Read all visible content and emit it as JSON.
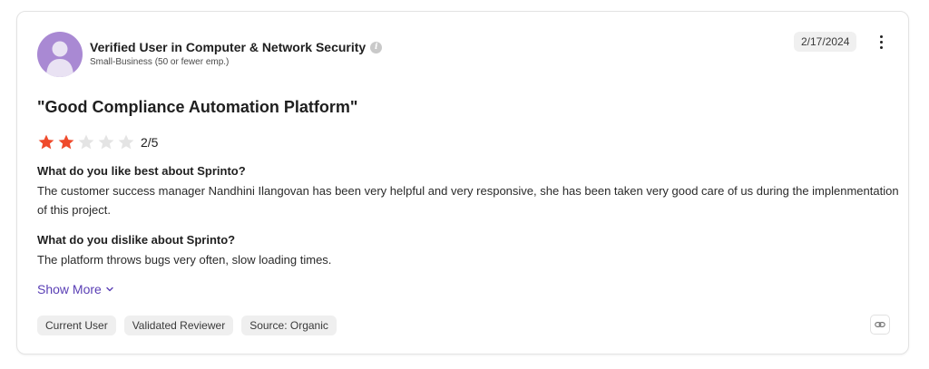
{
  "review": {
    "reviewer_name": "Verified User in Computer & Network Security",
    "reviewer_segment": "Small-Business (50 or fewer emp.)",
    "info_symbol": "i",
    "date": "2/17/2024",
    "title": "\"Good Compliance Automation Platform\"",
    "rating": 2,
    "rating_max": 5,
    "rating_text": "2/5",
    "qa": [
      {
        "question": "What do you like best about Sprinto?",
        "answer": "The customer success manager Nandhini Ilangovan has been very helpful and very responsive, she has been taken very good care of us during the implenmentation of this project."
      },
      {
        "question": "What do you dislike about Sprinto?",
        "answer": "The platform throws bugs very often, slow loading times."
      }
    ],
    "show_more_label": "Show More",
    "tags": [
      "Current User",
      "Validated Reviewer",
      "Source: Organic"
    ]
  },
  "colors": {
    "star_filled": "#ef4b2c",
    "star_empty": "#e4e4e4",
    "avatar_bg": "#a989d3",
    "link_accent": "#5a3fb5"
  },
  "icons": {
    "avatar": "user-silhouette-icon",
    "info": "info-icon",
    "menu": "kebab-menu-icon",
    "show_more": "chevron-down-icon",
    "copy_link": "link-icon"
  }
}
